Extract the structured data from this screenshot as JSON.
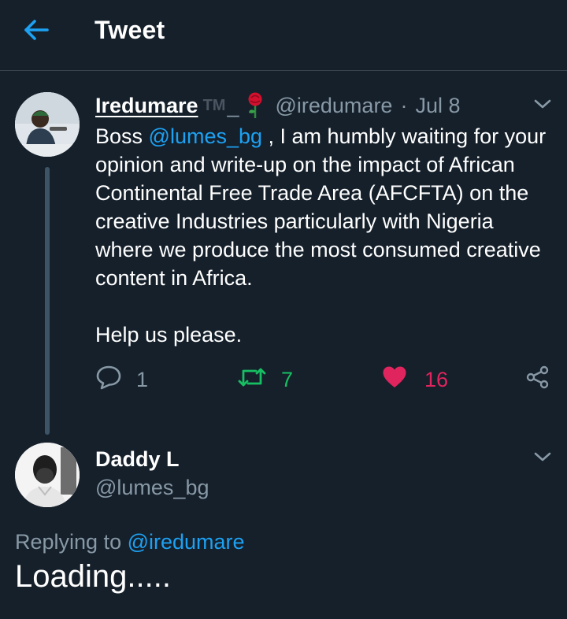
{
  "header": {
    "title": "Tweet"
  },
  "tweet1": {
    "name": "Iredumare",
    "name_suffix": "TM",
    "name_mark": "_",
    "handle": "@iredumare",
    "separator": "·",
    "date": "Jul 8",
    "body": {
      "p1_prefix": "Boss ",
      "p1_mention": "@lumes_bg",
      "p1_rest": " , I am humbly waiting for your opinion and write-up on the impact of African Continental Free Trade Area (AFCFTA) on the creative Industries particularly with Nigeria where we  produce the most consumed creative content in Africa.",
      "p2": "Help us please."
    },
    "stats": {
      "replies": "1",
      "retweets": "7",
      "likes": "16"
    },
    "colors": {
      "retweet": "#17bf63",
      "like": "#e0245e",
      "mention": "#1da1f2"
    }
  },
  "tweet2": {
    "name": "Daddy L",
    "handle": "@lumes_bg",
    "replying_label": "Replying to ",
    "replying_mention": "@iredumare",
    "text": "Loading....."
  },
  "icons": {
    "back": "arrow-left-icon",
    "chevron": "chevron-down-icon",
    "rose": "rose-emoji-icon",
    "reply": "reply-icon",
    "retweet": "retweet-icon",
    "like": "heart-icon",
    "share": "share-icon"
  }
}
